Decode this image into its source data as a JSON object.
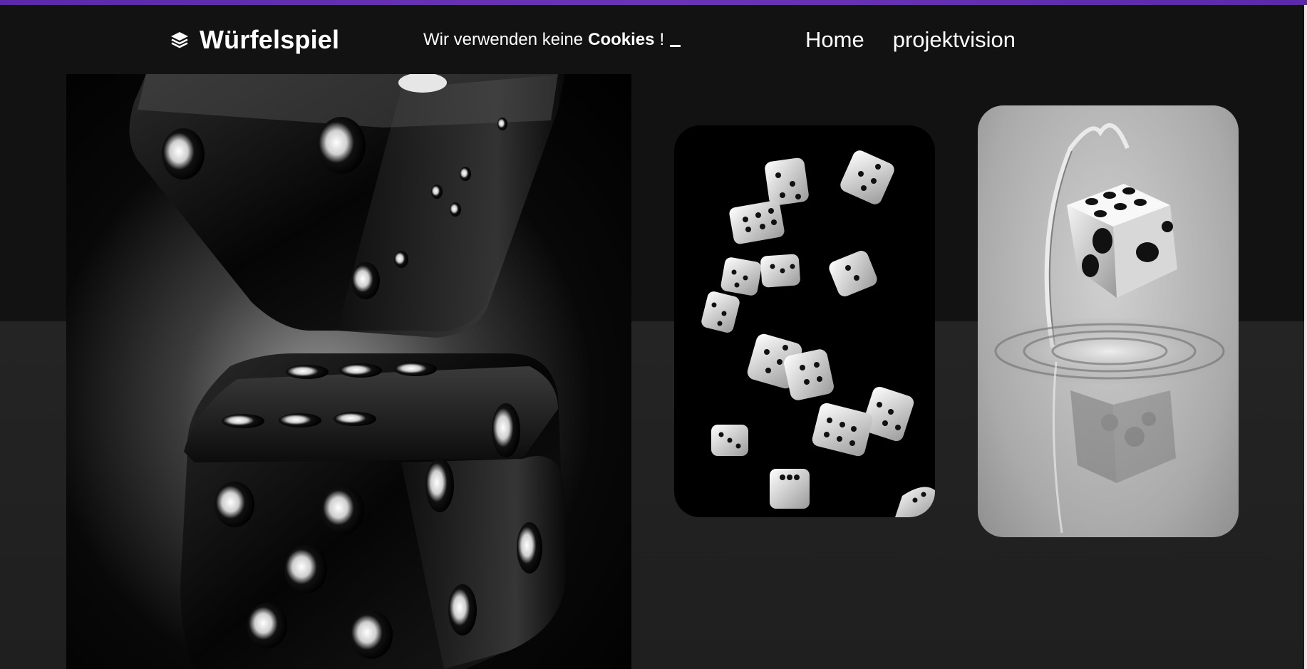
{
  "header": {
    "brand_name": "Würfelspiel",
    "brand_icon": "layers-icon",
    "cookie_text": "Wir verwenden keine",
    "cookie_bold": "Cookies",
    "cookie_suffix": "!",
    "nav": [
      {
        "label": "Home"
      },
      {
        "label": "projektvision"
      }
    ]
  },
  "images": {
    "hero": "black-glossy-dice-photo",
    "card_left": "falling-white-dice-photo",
    "card_right": "dice-splashing-water-photo"
  },
  "colors": {
    "accent_bar": "#5b2aa8",
    "header_bg": "#121212",
    "page_bg": "#1e1e1e",
    "text": "#ffffff"
  }
}
